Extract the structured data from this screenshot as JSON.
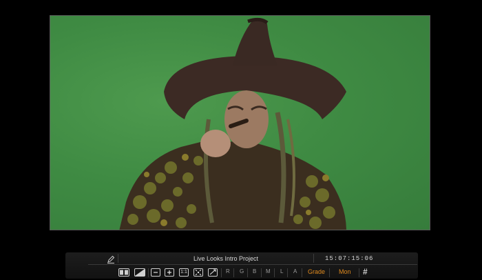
{
  "viewer": {
    "content": "video frame: costumed witch with pointed brown hat and pipe against green screen",
    "background_color": "#3f8b43"
  },
  "toolbar": {
    "pen_icon": "pen-icon",
    "project_title": "Live Looks Intro Project",
    "timecode": "15:07:15:06",
    "buttons": {
      "split_view": "split-view-icon",
      "wipe": "wipe-icon",
      "zoom_out": "zoom-out-icon",
      "zoom_in": "zoom-in-icon",
      "actual_size": "1:1",
      "fit": "fit-icon",
      "fullscreen": "expand-icon"
    },
    "channels": [
      "R",
      "G",
      "B",
      "M",
      "L",
      "A"
    ],
    "grade_label": "Grade",
    "mon_label": "Mon",
    "grid_symbol": "#",
    "accent_color": "#e08a1e"
  }
}
